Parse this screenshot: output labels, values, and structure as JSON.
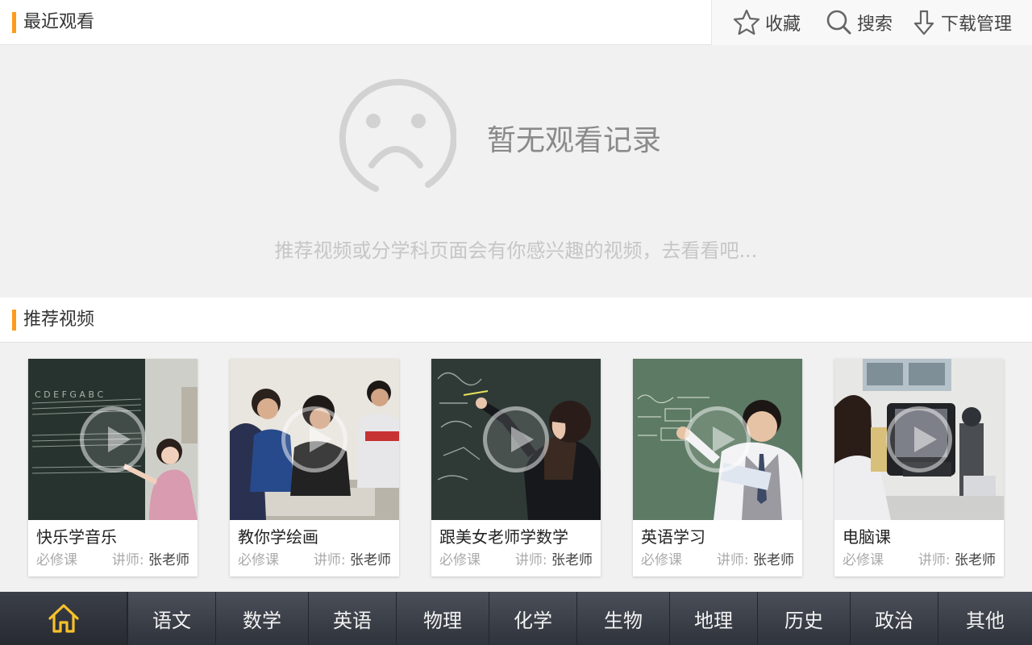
{
  "header": {
    "title": "最近观看",
    "actions": [
      {
        "label": "收藏",
        "icon": "star-icon"
      },
      {
        "label": "搜索",
        "icon": "search-icon"
      },
      {
        "label": "下载管理",
        "icon": "download-icon"
      }
    ]
  },
  "empty_state": {
    "icon": "sad-face-icon",
    "title": "暂无观看记录",
    "hint": "推荐视频或分学科页面会有你感兴趣的视频，去看看吧..."
  },
  "recommended": {
    "title": "推荐视频",
    "videos": [
      {
        "title": "快乐学音乐",
        "type": "必修课",
        "teacher_label": "讲师:",
        "teacher": "张老师"
      },
      {
        "title": "教你学绘画",
        "type": "必修课",
        "teacher_label": "讲师:",
        "teacher": "张老师"
      },
      {
        "title": "跟美女老师学数学",
        "type": "必修课",
        "teacher_label": "讲师:",
        "teacher": "张老师"
      },
      {
        "title": "英语学习",
        "type": "必修课",
        "teacher_label": "讲师:",
        "teacher": "张老师"
      },
      {
        "title": "电脑课",
        "type": "必修课",
        "teacher_label": "讲师:",
        "teacher": "张老师"
      }
    ]
  },
  "bottom_nav": {
    "home_icon": "home-icon",
    "items": [
      "语文",
      "数学",
      "英语",
      "物理",
      "化学",
      "生物",
      "地理",
      "历史",
      "政治",
      "其他"
    ]
  },
  "colors": {
    "accent": "#ff9a1a",
    "home_icon": "#f7c12b",
    "nav_bg": "#383c45"
  }
}
